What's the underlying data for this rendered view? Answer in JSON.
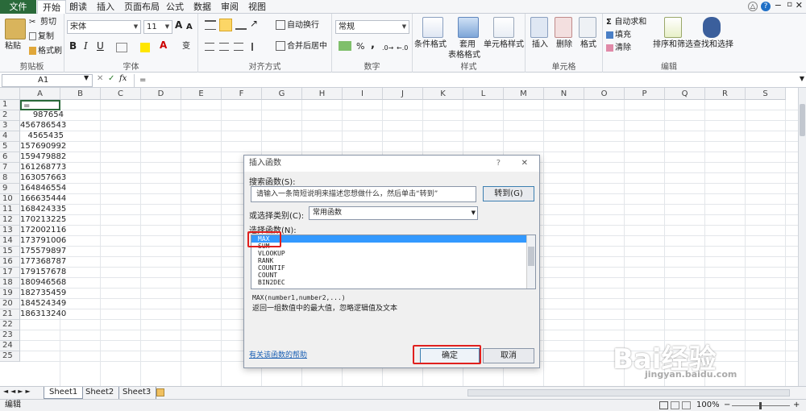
{
  "menubar": {
    "file": "文件",
    "tabs": [
      "开始",
      "朗读",
      "插入",
      "页面布局",
      "公式",
      "数据",
      "审阅",
      "视图"
    ]
  },
  "ribbon": {
    "clipboard": {
      "paste": "粘贴",
      "cut": "剪切",
      "copy": "复制",
      "format_painter": "格式刷",
      "label": "剪贴板"
    },
    "font": {
      "name": "宋体",
      "size": "11",
      "bold": "B",
      "italic": "I",
      "underline": "U",
      "font_color": "A",
      "grow": "A",
      "shrink": "A",
      "phonetic": "变",
      "label": "字体"
    },
    "alignment": {
      "wrap": "自动换行",
      "merge": "合并后居中",
      "label": "对齐方式"
    },
    "number": {
      "format": "常规",
      "percent": "%",
      "comma": ",",
      "label": "数字"
    },
    "styles": {
      "cond": "条件格式",
      "table1": "套用",
      "table2": "表格格式",
      "cell": "单元格样式",
      "label": "样式"
    },
    "cells": {
      "insert": "插入",
      "delete": "删除",
      "format": "格式",
      "label": "单元格"
    },
    "editing": {
      "autosum": "自动求和",
      "fill": "填充",
      "clear": "清除",
      "sort": "排序和筛选",
      "find": "查找和选择",
      "label": "编辑"
    }
  },
  "formula_bar": {
    "name_box": "A1",
    "fx": "fx",
    "content": "="
  },
  "columns": [
    "A",
    "B",
    "C",
    "D",
    "E",
    "F",
    "G",
    "H",
    "I",
    "J",
    "K",
    "L",
    "M",
    "N",
    "O",
    "P",
    "Q",
    "R",
    "S"
  ],
  "rows": [
    "1",
    "2",
    "3",
    "4",
    "5",
    "6",
    "7",
    "8",
    "9",
    "10",
    "11",
    "12",
    "13",
    "14",
    "15",
    "16",
    "17",
    "18",
    "19",
    "20",
    "21",
    "22",
    "23",
    "24",
    "25"
  ],
  "a_values": [
    "=",
    "987654",
    "456786543",
    "4565435",
    "157690992",
    "159479882",
    "161268773",
    "163057663",
    "164846554",
    "166635444",
    "168424335",
    "170213225",
    "172002116",
    "173791006",
    "175579897",
    "177368787",
    "179157678",
    "180946568",
    "182735459",
    "184524349",
    "186313240"
  ],
  "sheets": [
    "Sheet1",
    "Sheet2",
    "Sheet3"
  ],
  "status": {
    "mode": "编辑",
    "zoom": "100%",
    "minus": "−",
    "plus": "+"
  },
  "dialog": {
    "title": "插入函数",
    "help": "?",
    "close": "✕",
    "search_label": "搜索函数(S):",
    "search_placeholder": "请输入一条简短说明来描述您想做什么，然后单击“转到”",
    "go": "转到(G)",
    "category_label": "或选择类别(C):",
    "category_value": "常用函数",
    "list_label": "选择函数(N):",
    "functions": [
      "MAX",
      "SUM",
      "VLOOKUP",
      "RANK",
      "COUNTIF",
      "COUNT",
      "BIN2DEC"
    ],
    "signature": "MAX(number1,number2,...)",
    "description": "返回一组数值中的最大值，忽略逻辑值及文本",
    "help_link": "有关该函数的帮助",
    "ok": "确定",
    "cancel": "取消"
  },
  "watermark": {
    "brand": "Bai经验",
    "url": "jingyan.baidu.com"
  }
}
